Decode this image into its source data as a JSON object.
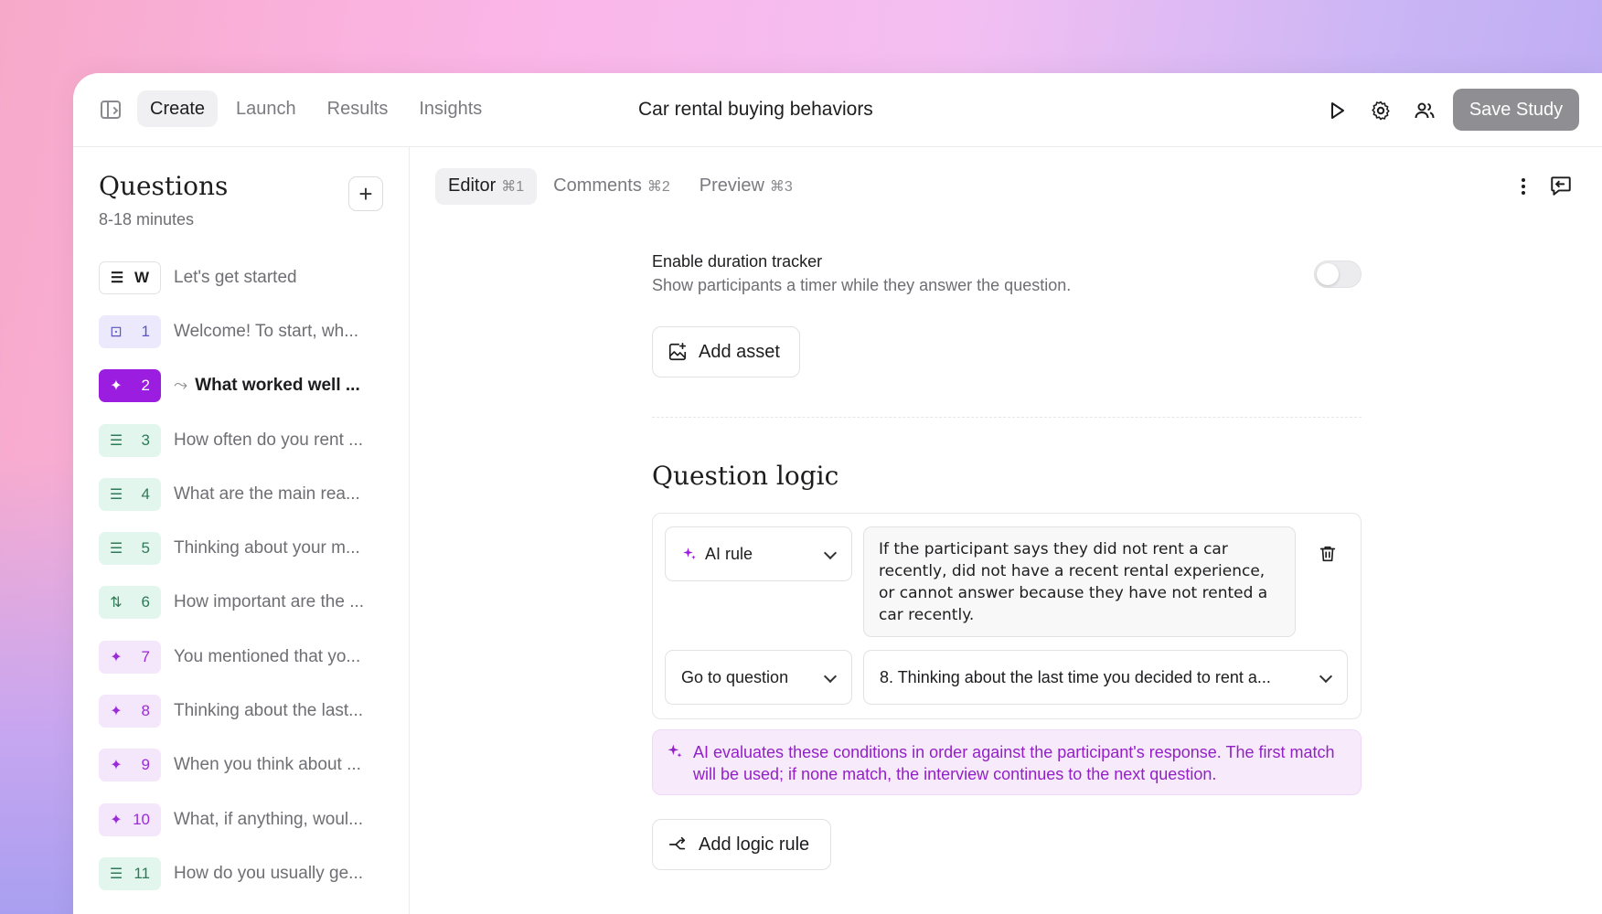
{
  "nav": {
    "tabs": [
      {
        "label": "Create"
      },
      {
        "label": "Launch"
      },
      {
        "label": "Results"
      },
      {
        "label": "Insights"
      }
    ],
    "title": "Car rental buying behaviors",
    "save_label": "Save Study"
  },
  "questions": {
    "title": "Questions",
    "duration": "8-18 minutes",
    "items": [
      {
        "badge": "W",
        "type": "welcome",
        "text": "Let's get started"
      },
      {
        "badge": "1",
        "type": "screener",
        "text": "Welcome! To start, wh..."
      },
      {
        "badge": "2",
        "type": "ai",
        "text": "What worked well ..."
      },
      {
        "badge": "3",
        "type": "list",
        "text": "How often do you rent ..."
      },
      {
        "badge": "4",
        "type": "list",
        "text": "What are the main rea..."
      },
      {
        "badge": "5",
        "type": "list",
        "text": "Thinking about your m..."
      },
      {
        "badge": "6",
        "type": "rank",
        "text": "How important are the ..."
      },
      {
        "badge": "7",
        "type": "ai",
        "text": "You mentioned that yo..."
      },
      {
        "badge": "8",
        "type": "ai",
        "text": "Thinking about the last..."
      },
      {
        "badge": "9",
        "type": "ai",
        "text": "When you think about ..."
      },
      {
        "badge": "10",
        "type": "ai",
        "text": "What, if anything, woul..."
      },
      {
        "badge": "11",
        "type": "list",
        "text": "How do you usually ge..."
      }
    ]
  },
  "editor": {
    "tabs": [
      {
        "label": "Editor",
        "shortcut": "⌘1"
      },
      {
        "label": "Comments",
        "shortcut": "⌘2"
      },
      {
        "label": "Preview",
        "shortcut": "⌘3"
      }
    ],
    "duration_tracker": {
      "title": "Enable duration tracker",
      "description": "Show participants a timer while they answer the question.",
      "enabled": false
    },
    "add_asset_label": "Add asset",
    "logic": {
      "title": "Question logic",
      "rule_type": "AI rule",
      "rule_text": "If the participant says they did not rent a car recently, did not have a recent rental experience, or cannot answer because they have not rented a car recently.",
      "action": "Go to question",
      "target": "8. Thinking about the last time you decided to rent a...",
      "note": "AI evaluates these conditions in order against the participant's response. The first match will be used; if none match, the interview continues to the next question.",
      "add_rule_label": "Add logic rule"
    }
  },
  "colors": {
    "accent_purple": "#9b1ddf",
    "ai_note_text": "#9320c7",
    "save_button": "#8e8e93"
  }
}
